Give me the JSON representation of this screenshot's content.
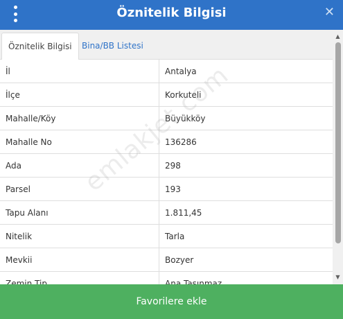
{
  "header": {
    "title": "Öznitelik Bilgisi",
    "menu_icon": "vertical-dots-icon",
    "close_icon": "close-icon",
    "close_glyph": "✕",
    "background": "#2f73c8"
  },
  "tabs": [
    {
      "label": "Öznitelik Bilgisi",
      "active": true
    },
    {
      "label": "Bina/BB Listesi",
      "active": false
    }
  ],
  "rows": [
    {
      "key": "İl",
      "value": "Antalya"
    },
    {
      "key": "İlçe",
      "value": "Korkuteli"
    },
    {
      "key": "Mahalle/Köy",
      "value": "Büyükköy"
    },
    {
      "key": "Mahalle No",
      "value": "136286"
    },
    {
      "key": "Ada",
      "value": "298"
    },
    {
      "key": "Parsel",
      "value": "193"
    },
    {
      "key": "Tapu Alanı",
      "value": "1.811,45"
    },
    {
      "key": "Nitelik",
      "value": "Tarla"
    },
    {
      "key": "Mevkii",
      "value": "Bozyer"
    },
    {
      "key": "Zemin Tip",
      "value": "Ana Taşınmaz"
    }
  ],
  "scrollbar": {
    "up_glyph": "▲",
    "down_glyph": "▼"
  },
  "watermark": "emlakjet.com",
  "footer": {
    "button_label": "Favorilere ekle",
    "background": "#4eb060"
  }
}
